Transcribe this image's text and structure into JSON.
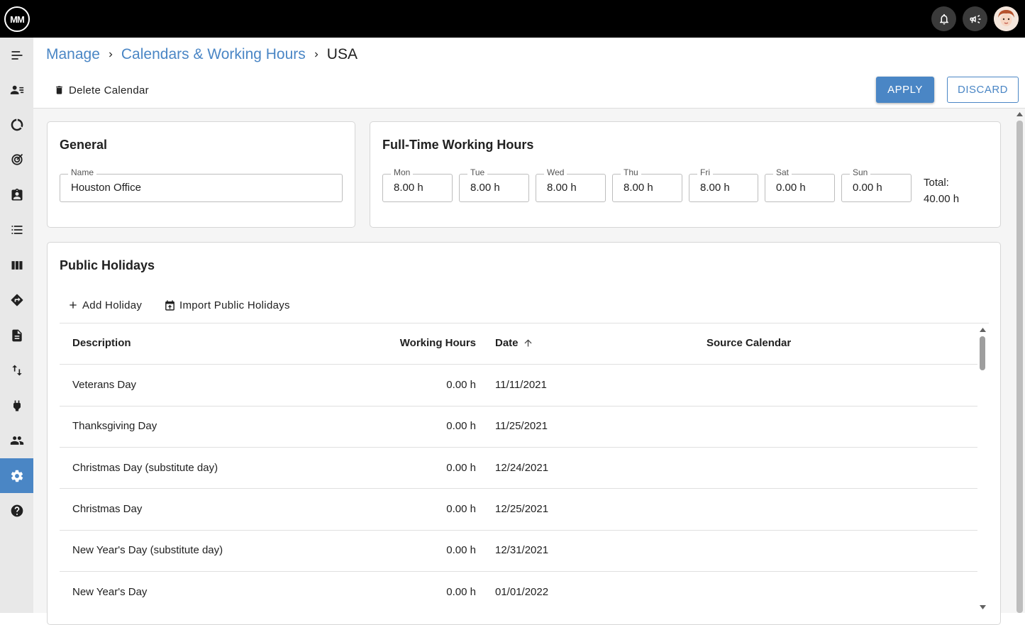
{
  "app": {
    "logo_text": "MM"
  },
  "breadcrumb": {
    "items": [
      "Manage",
      "Calendars & Working Hours"
    ],
    "current": "USA"
  },
  "toolbar": {
    "delete_label": "Delete Calendar",
    "apply_label": "APPLY",
    "discard_label": "DISCARD"
  },
  "general": {
    "title": "General",
    "name_label": "Name",
    "name_value": "Houston Office"
  },
  "working_hours": {
    "title": "Full-Time Working Hours",
    "days": [
      {
        "label": "Mon",
        "value": "8.00 h"
      },
      {
        "label": "Tue",
        "value": "8.00 h"
      },
      {
        "label": "Wed",
        "value": "8.00 h"
      },
      {
        "label": "Thu",
        "value": "8.00 h"
      },
      {
        "label": "Fri",
        "value": "8.00 h"
      },
      {
        "label": "Sat",
        "value": "0.00 h"
      },
      {
        "label": "Sun",
        "value": "0.00 h"
      }
    ],
    "total_label": "Total:",
    "total_value": "40.00 h"
  },
  "holidays": {
    "title": "Public Holidays",
    "add_label": "Add Holiday",
    "import_label": "Import Public Holidays",
    "columns": {
      "description": "Description",
      "hours": "Working Hours",
      "date": "Date",
      "source": "Source Calendar"
    },
    "rows": [
      {
        "description": "Veterans Day",
        "hours": "0.00 h",
        "date": "11/11/2021",
        "source": ""
      },
      {
        "description": "Thanksgiving Day",
        "hours": "0.00 h",
        "date": "11/25/2021",
        "source": ""
      },
      {
        "description": "Christmas Day (substitute day)",
        "hours": "0.00 h",
        "date": "12/24/2021",
        "source": ""
      },
      {
        "description": "Christmas Day",
        "hours": "0.00 h",
        "date": "12/25/2021",
        "source": ""
      },
      {
        "description": "New Year's Day (substitute day)",
        "hours": "0.00 h",
        "date": "12/31/2021",
        "source": ""
      },
      {
        "description": "New Year's Day",
        "hours": "0.00 h",
        "date": "01/01/2022",
        "source": ""
      }
    ]
  },
  "colors": {
    "accent": "#4a86c5",
    "topbar": "#000000",
    "sidebar": "#e8e8e8"
  }
}
